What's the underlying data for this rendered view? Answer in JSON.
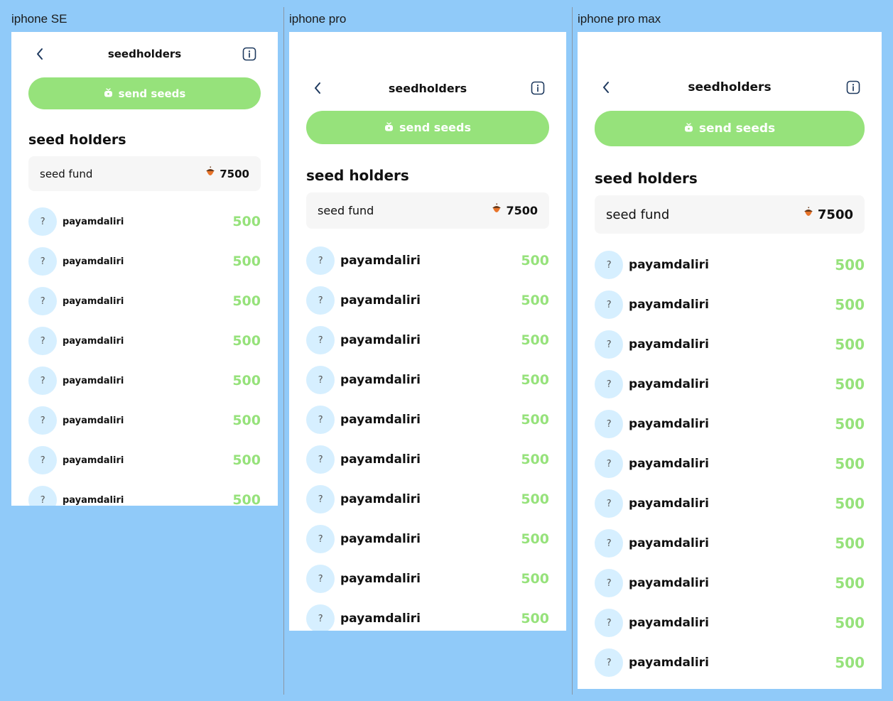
{
  "frames": [
    {
      "label": "iphone SE",
      "header_title": "seedholders",
      "send_label": "send seeds",
      "section_title": "seed holders",
      "fund": {
        "label": "seed fund",
        "amount": "7500"
      },
      "holders": [
        {
          "name": "payamdaliri",
          "amount": "500",
          "avatar": "?"
        },
        {
          "name": "payamdaliri",
          "amount": "500",
          "avatar": "?"
        },
        {
          "name": "payamdaliri",
          "amount": "500",
          "avatar": "?"
        },
        {
          "name": "payamdaliri",
          "amount": "500",
          "avatar": "?"
        },
        {
          "name": "payamdaliri",
          "amount": "500",
          "avatar": "?"
        },
        {
          "name": "payamdaliri",
          "amount": "500",
          "avatar": "?"
        },
        {
          "name": "payamdaliri",
          "amount": "500",
          "avatar": "?"
        },
        {
          "name": "payamdaliri",
          "amount": "500",
          "avatar": "?"
        }
      ]
    },
    {
      "label": "iphone pro",
      "header_title": "seedholders",
      "send_label": "send seeds",
      "section_title": "seed holders",
      "fund": {
        "label": "seed fund",
        "amount": "7500"
      },
      "holders": [
        {
          "name": "payamdaliri",
          "amount": "500",
          "avatar": "?"
        },
        {
          "name": "payamdaliri",
          "amount": "500",
          "avatar": "?"
        },
        {
          "name": "payamdaliri",
          "amount": "500",
          "avatar": "?"
        },
        {
          "name": "payamdaliri",
          "amount": "500",
          "avatar": "?"
        },
        {
          "name": "payamdaliri",
          "amount": "500",
          "avatar": "?"
        },
        {
          "name": "payamdaliri",
          "amount": "500",
          "avatar": "?"
        },
        {
          "name": "payamdaliri",
          "amount": "500",
          "avatar": "?"
        },
        {
          "name": "payamdaliri",
          "amount": "500",
          "avatar": "?"
        },
        {
          "name": "payamdaliri",
          "amount": "500",
          "avatar": "?"
        },
        {
          "name": "payamdaliri",
          "amount": "500",
          "avatar": "?"
        }
      ]
    },
    {
      "label": "iphone pro max",
      "header_title": "seedholders",
      "send_label": "send seeds",
      "section_title": "seed holders",
      "fund": {
        "label": "seed fund",
        "amount": "7500"
      },
      "holders": [
        {
          "name": "payamdaliri",
          "amount": "500",
          "avatar": "?"
        },
        {
          "name": "payamdaliri",
          "amount": "500",
          "avatar": "?"
        },
        {
          "name": "payamdaliri",
          "amount": "500",
          "avatar": "?"
        },
        {
          "name": "payamdaliri",
          "amount": "500",
          "avatar": "?"
        },
        {
          "name": "payamdaliri",
          "amount": "500",
          "avatar": "?"
        },
        {
          "name": "payamdaliri",
          "amount": "500",
          "avatar": "?"
        },
        {
          "name": "payamdaliri",
          "amount": "500",
          "avatar": "?"
        },
        {
          "name": "payamdaliri",
          "amount": "500",
          "avatar": "?"
        },
        {
          "name": "payamdaliri",
          "amount": "500",
          "avatar": "?"
        },
        {
          "name": "payamdaliri",
          "amount": "500",
          "avatar": "?"
        },
        {
          "name": "payamdaliri",
          "amount": "500",
          "avatar": "?"
        }
      ]
    }
  ],
  "colors": {
    "background": "#90caf9",
    "accent": "#96e27b",
    "avatar_bg": "#d6efff",
    "card_bg": "#f6f6f6",
    "icon": "#1f3a5f"
  },
  "icons": {
    "back": "chevron-left-icon",
    "info": "info-icon",
    "send": "seed-bag-icon",
    "fund": "acorn-icon"
  }
}
